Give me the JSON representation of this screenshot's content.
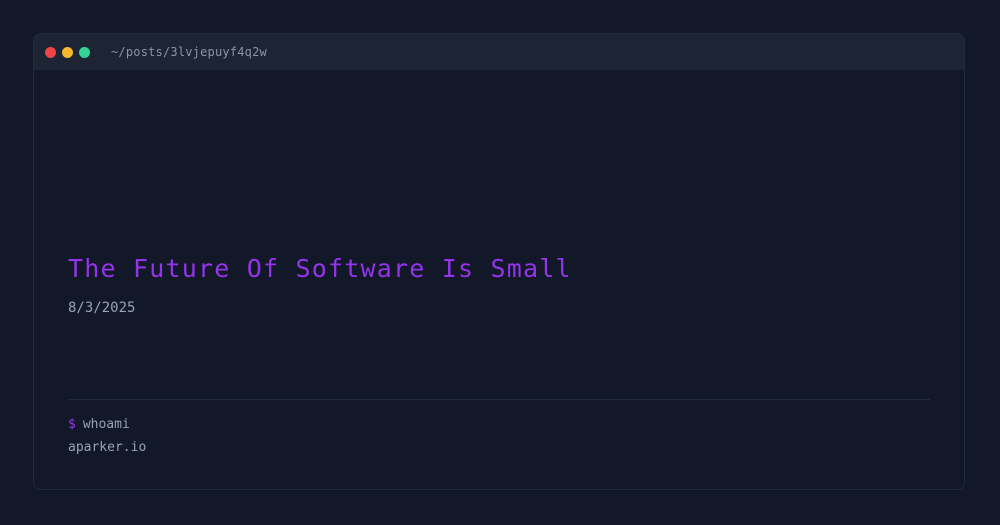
{
  "window": {
    "path": "~/posts/3lvjepuyf4q2w",
    "controls": {
      "close_color": "#ef4444",
      "minimize_color": "#f5b82e",
      "maximize_color": "#34d399"
    }
  },
  "post": {
    "title": "The Future Of Software Is Small",
    "date": "8/3/2025"
  },
  "footer": {
    "prompt_symbol": "$",
    "command": "whoami",
    "output": "aparker.io"
  },
  "colors": {
    "background": "#121828",
    "titlebar": "#1d2433",
    "accent": "#9333ea",
    "muted_text": "#9aa1b1"
  }
}
